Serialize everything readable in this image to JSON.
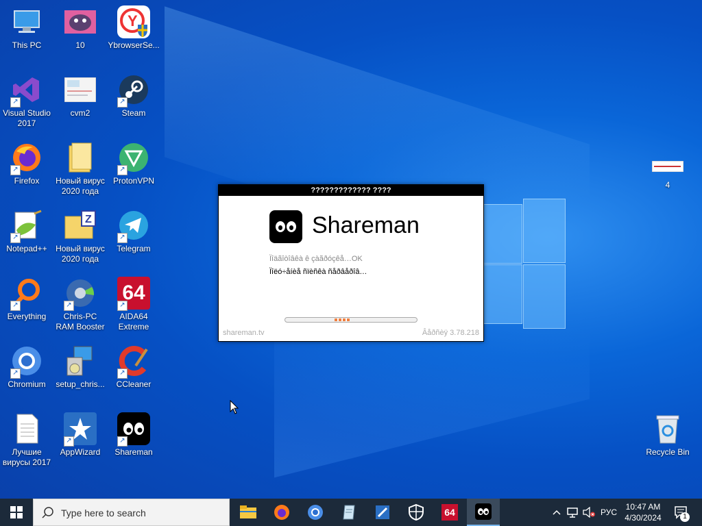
{
  "desktop_icons": [
    {
      "label": "This PC"
    },
    {
      "label": "10"
    },
    {
      "label": "YbrowserSe..."
    },
    {
      "label": "Visual Studio 2017"
    },
    {
      "label": "cvm2"
    },
    {
      "label": "Steam"
    },
    {
      "label": "Firefox"
    },
    {
      "label": "Новый вирус 2020 года"
    },
    {
      "label": "ProtonVPN"
    },
    {
      "label": "Notepad++"
    },
    {
      "label": "Новый вирус 2020 года"
    },
    {
      "label": "Telegram"
    },
    {
      "label": "Everything"
    },
    {
      "label": "Chris-PC RAM Booster"
    },
    {
      "label": "AIDA64 Extreme"
    },
    {
      "label": "Chromium"
    },
    {
      "label": "setup_chris..."
    },
    {
      "label": "CCleaner"
    },
    {
      "label": "Лучшие вирусы 2017"
    },
    {
      "label": "AppWizard"
    },
    {
      "label": "Shareman"
    },
    {
      "label": "4"
    },
    {
      "label": "Recycle Bin"
    }
  ],
  "dialog": {
    "title": "????????????? ????",
    "app_name": "Shareman",
    "status_line1": "Ïîäãîòîâêà ê çàãðóçêå…OK",
    "status_line2": "Ïîëó÷åíèå ñïèñêà ñåðâåðîâ…",
    "footer_left": "shareman.tv",
    "footer_right": "Âåðñèÿ 3.78.218"
  },
  "taskbar": {
    "search_placeholder": "Type here to search",
    "aida_label": "64",
    "language": "РУС",
    "time": "10:47 AM",
    "date": "4/30/2024",
    "notification_count": "1"
  }
}
